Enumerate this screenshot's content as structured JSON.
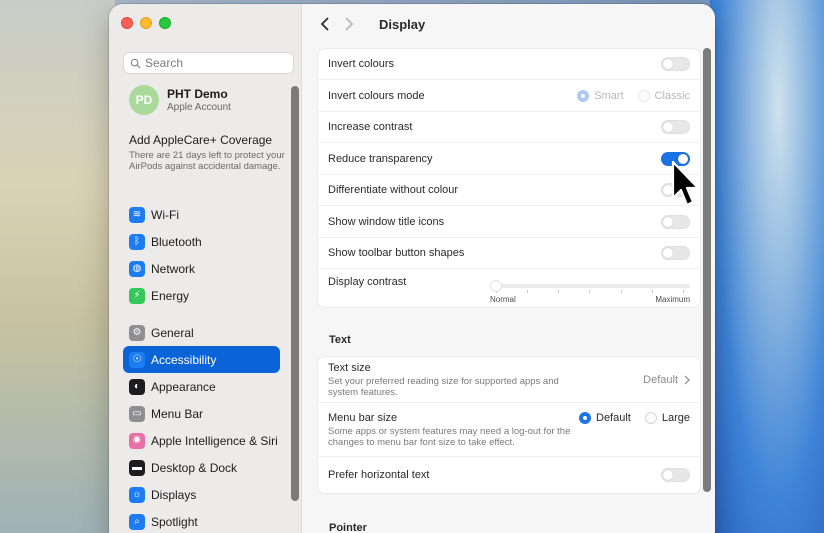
{
  "window": {
    "title": "Display"
  },
  "search": {
    "placeholder": "Search"
  },
  "account": {
    "initials": "PD",
    "name": "PHT Demo",
    "subtitle": "Apple Account"
  },
  "applecare": {
    "title": "Add AppleCare+ Coverage",
    "text": "There are 21 days left to protect your AirPods against accidental damage."
  },
  "sidebar": {
    "groupA": [
      {
        "label": "Wi-Fi",
        "icon": "wifi-icon",
        "color": "#1e7cf2",
        "glyph": "≋"
      },
      {
        "label": "Bluetooth",
        "icon": "bluetooth-icon",
        "color": "#1e7cf2",
        "glyph": "ᛒ"
      },
      {
        "label": "Network",
        "icon": "globe-icon",
        "color": "#1e7cf2",
        "glyph": "◍"
      },
      {
        "label": "Energy",
        "icon": "battery-icon",
        "color": "#34c759",
        "glyph": "⚡"
      }
    ],
    "groupB": [
      {
        "label": "General",
        "icon": "gear-icon",
        "color": "#8e8e93",
        "glyph": "⚙"
      },
      {
        "label": "Accessibility",
        "icon": "accessibility-icon",
        "color": "#1e7cf2",
        "glyph": "☉",
        "active": true
      },
      {
        "label": "Appearance",
        "icon": "appearance-icon",
        "color": "#1d1d1f",
        "glyph": "◐"
      },
      {
        "label": "Menu Bar",
        "icon": "menubar-icon",
        "color": "#8e8e93",
        "glyph": "▭"
      },
      {
        "label": "Apple Intelligence & Siri",
        "icon": "siri-icon",
        "color": "#e86fa8",
        "glyph": "✺"
      },
      {
        "label": "Desktop & Dock",
        "icon": "dock-icon",
        "color": "#1d1d1f",
        "glyph": "▬"
      },
      {
        "label": "Displays",
        "icon": "displays-icon",
        "color": "#1e7cf2",
        "glyph": "☼"
      },
      {
        "label": "Spotlight",
        "icon": "spotlight-icon",
        "color": "#1e7cf2",
        "glyph": "⌕"
      }
    ]
  },
  "display": {
    "invert_colours": {
      "label": "Invert colours",
      "on": false
    },
    "invert_mode": {
      "label": "Invert colours mode",
      "options": [
        "Smart",
        "Classic"
      ],
      "selected": "Smart"
    },
    "increase_contrast": {
      "label": "Increase contrast",
      "on": false
    },
    "reduce_transparency": {
      "label": "Reduce transparency",
      "on": true
    },
    "differentiate": {
      "label": "Differentiate without colour",
      "on": false
    },
    "window_title_icons": {
      "label": "Show window title icons",
      "on": false
    },
    "toolbar_shapes": {
      "label": "Show toolbar button shapes",
      "on": false
    },
    "display_contrast": {
      "label": "Display contrast",
      "min_label": "Normal",
      "max_label": "Maximum",
      "value": 0
    }
  },
  "text_section": {
    "heading": "Text",
    "text_size": {
      "label": "Text size",
      "sub": "Set your preferred reading size for supported apps and system features.",
      "value": "Default"
    },
    "menu_bar_size": {
      "label": "Menu bar size",
      "sub": "Some apps or system features may need a log-out for the changes to menu bar font size to take effect.",
      "options": [
        "Default",
        "Large"
      ],
      "selected": "Default"
    },
    "prefer_horizontal": {
      "label": "Prefer horizontal text",
      "on": false
    }
  },
  "pointer_section": {
    "heading": "Pointer"
  }
}
